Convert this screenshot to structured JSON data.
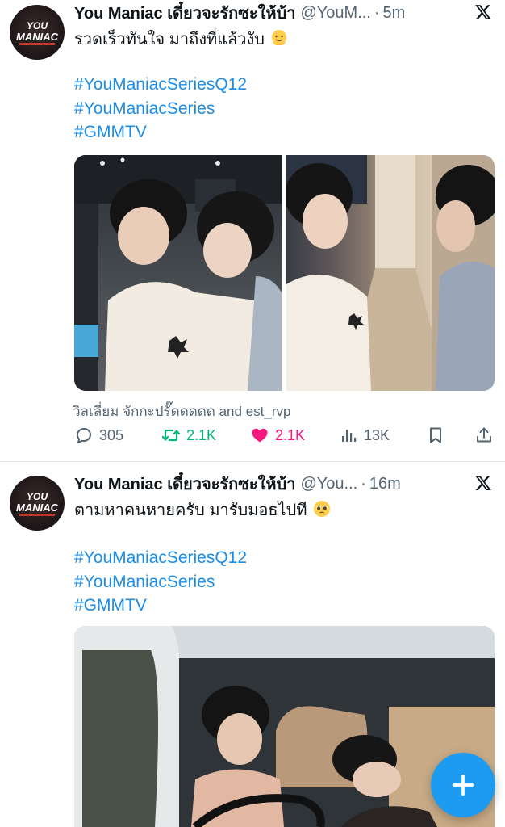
{
  "tweets": [
    {
      "display_name": "You Maniac เดี๋ยวจะรักซะให้บ้า",
      "handle": "@YouM...",
      "separator": "·",
      "time": "5m",
      "text": "รวดเร็วทันใจ มาถึงที่แล้วงับ",
      "emoji": "melting-face-icon",
      "hashtags": [
        "#YouManiacSeriesQ12",
        "#YouManiacSeries",
        "#GMMTV"
      ],
      "media_credits": "วิลเลี่ยม จักกะปรั๊ดดดดด and est_rvp",
      "stats": {
        "replies": "305",
        "retweets": "2.1K",
        "likes": "2.1K",
        "views": "13K"
      },
      "liked": true
    },
    {
      "display_name": "You Maniac เดี๋ยวจะรักซะให้บ้า",
      "handle": "@You...",
      "separator": "·",
      "time": "16m",
      "text": "ตามหาคนหายครับ มารับมอธไปที",
      "emoji": "pleading-face-icon",
      "hashtags": [
        "#YouManiacSeriesQ12",
        "#YouManiacSeries",
        "#GMMTV"
      ]
    }
  ],
  "avatar_logo_text": [
    "YOU",
    "MANIAC"
  ],
  "colors": {
    "hashtag": "#1d8ce6",
    "retweet": "#00ba7c",
    "like": "#f91880",
    "fab": "#1d9bf0",
    "secondary_text": "#536471"
  }
}
